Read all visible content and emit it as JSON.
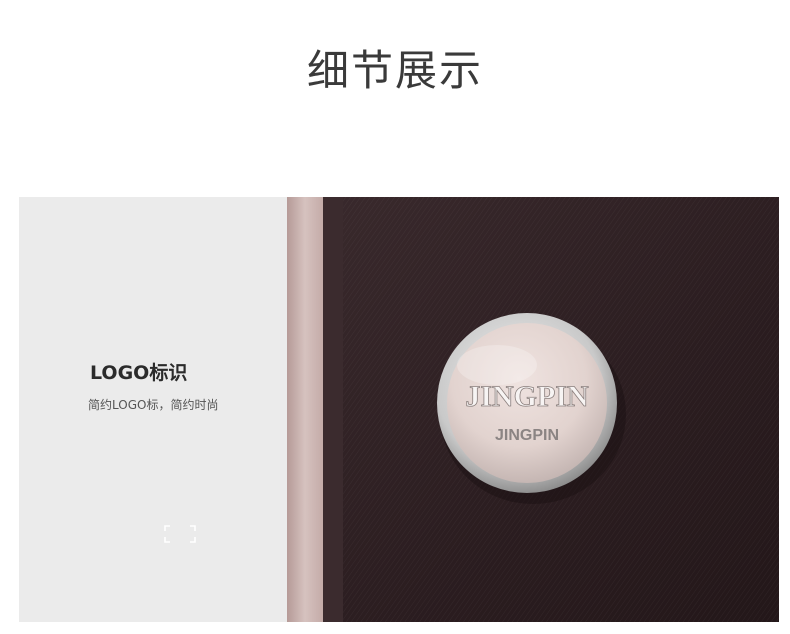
{
  "header": {
    "title": "细节展示"
  },
  "feature": {
    "title": "LOGO标识",
    "description": "简约LOGO标，简约时尚",
    "zoom_icon": "expand-corners-icon"
  },
  "product_photo": {
    "logo_text_primary": "JINGPIN",
    "logo_text_secondary": "JINGPIN",
    "fabric_color": "#2b1d20",
    "stripe_color": "#c9b1ad"
  }
}
